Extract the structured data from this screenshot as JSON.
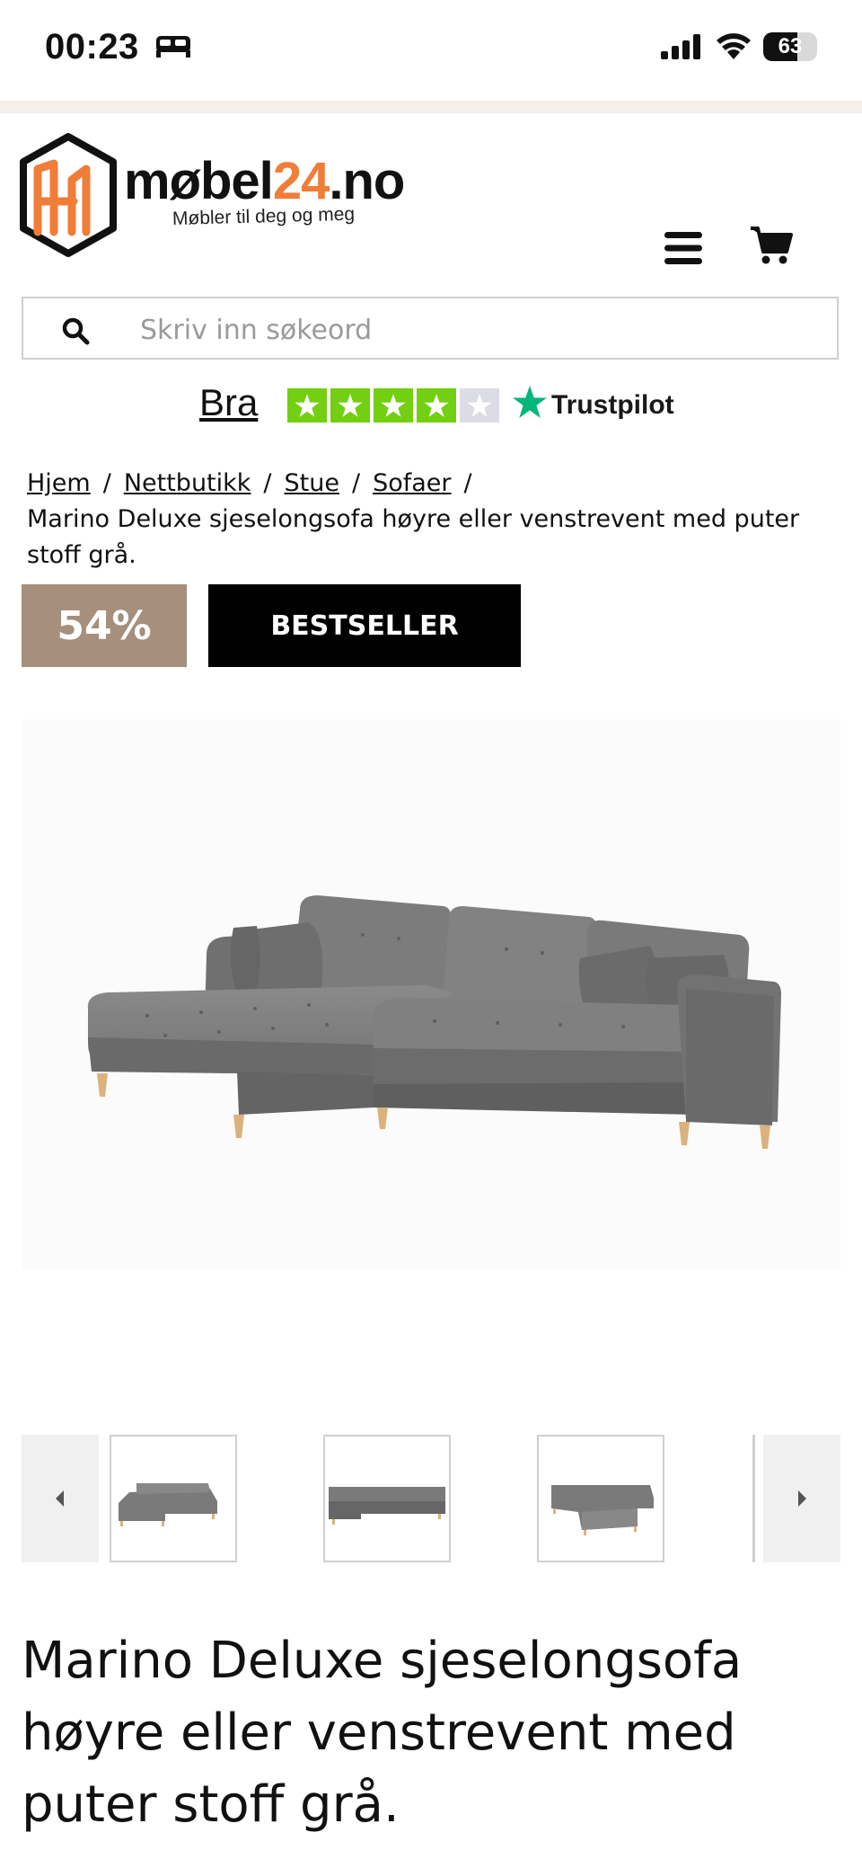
{
  "status_bar": {
    "time": "00:23",
    "battery": "63",
    "battery_fraction": 0.63
  },
  "header": {
    "logo_text_prefix": "møbel",
    "logo_text_accent": "24",
    "logo_text_suffix": ".no",
    "tagline": "Møbler til deg og meg",
    "icons": [
      "menu-icon",
      "cart-icon"
    ]
  },
  "search": {
    "placeholder": "Skriv inn søkeord"
  },
  "trustpilot": {
    "rating_word": "Bra",
    "stars_filled": 4,
    "stars_total": 5,
    "brand": "Trustpilot"
  },
  "breadcrumb": {
    "items": [
      "Hjem",
      "Nettbutikk",
      "Stue",
      "Sofaer"
    ],
    "separator": "/",
    "current": "Marino Deluxe sjeselongsofa høyre eller venstrevent med puter stoff grå."
  },
  "badges": {
    "discount": "54%",
    "bestseller": "BESTSELLER"
  },
  "product": {
    "title": "Marino Deluxe sjeselongsofa høyre eller venstrevent med puter stoff grå."
  },
  "colors": {
    "brand_orange": "#f07d38",
    "discount_badge": "#a68f7d",
    "trustpilot_green": "#00b67a",
    "star_green": "#73cf11"
  }
}
